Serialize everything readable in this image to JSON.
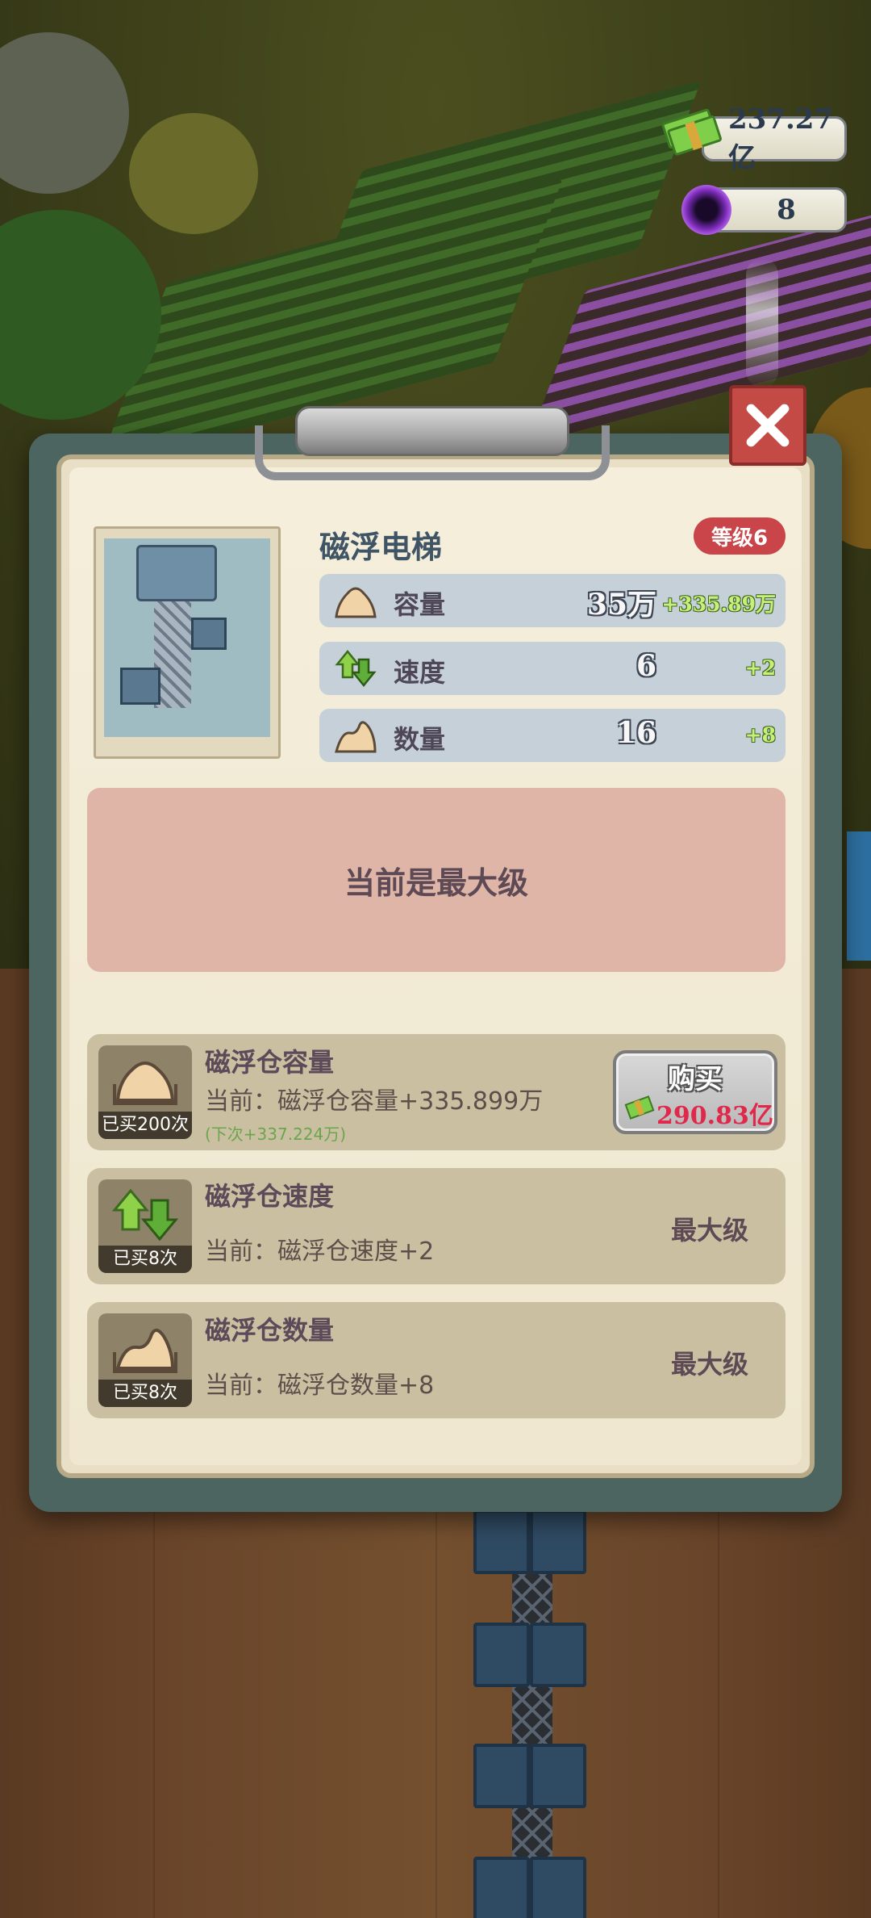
{
  "hud": {
    "money": "237.27亿",
    "gems": "8"
  },
  "dialog": {
    "title": "磁浮电梯",
    "level": "等级6",
    "stats": [
      {
        "label": "容量",
        "value": "35万",
        "increase": "+335.89万",
        "icon": "sand-pile-icon"
      },
      {
        "label": "速度",
        "value": "6",
        "increase": "+2",
        "icon": "up-down-arrows-icon"
      },
      {
        "label": "数量",
        "value": "16",
        "increase": "+8",
        "icon": "mound-icon"
      }
    ],
    "max_banner": "当前是最大级",
    "upgrades": [
      {
        "name": "磁浮仓容量",
        "bought": "已买200次",
        "current": "当前：磁浮仓容量+335.899万",
        "next": "(下次+337.224万)",
        "button_label": "购买",
        "price": "290.83亿",
        "icon": "sand-pile-icon"
      },
      {
        "name": "磁浮仓速度",
        "bought": "已买8次",
        "current": "当前：磁浮仓速度+2",
        "status": "最大级",
        "icon": "up-down-arrows-icon"
      },
      {
        "name": "磁浮仓数量",
        "bought": "已买8次",
        "current": "当前：磁浮仓数量+8",
        "status": "最大级",
        "icon": "mound-icon"
      }
    ]
  },
  "colors": {
    "level_badge": "#c9454a",
    "max_banner": "#dfb5a8",
    "increase_text": "#c9ef7b",
    "price_text": "#e0284a",
    "close_button": "#c44a45"
  }
}
